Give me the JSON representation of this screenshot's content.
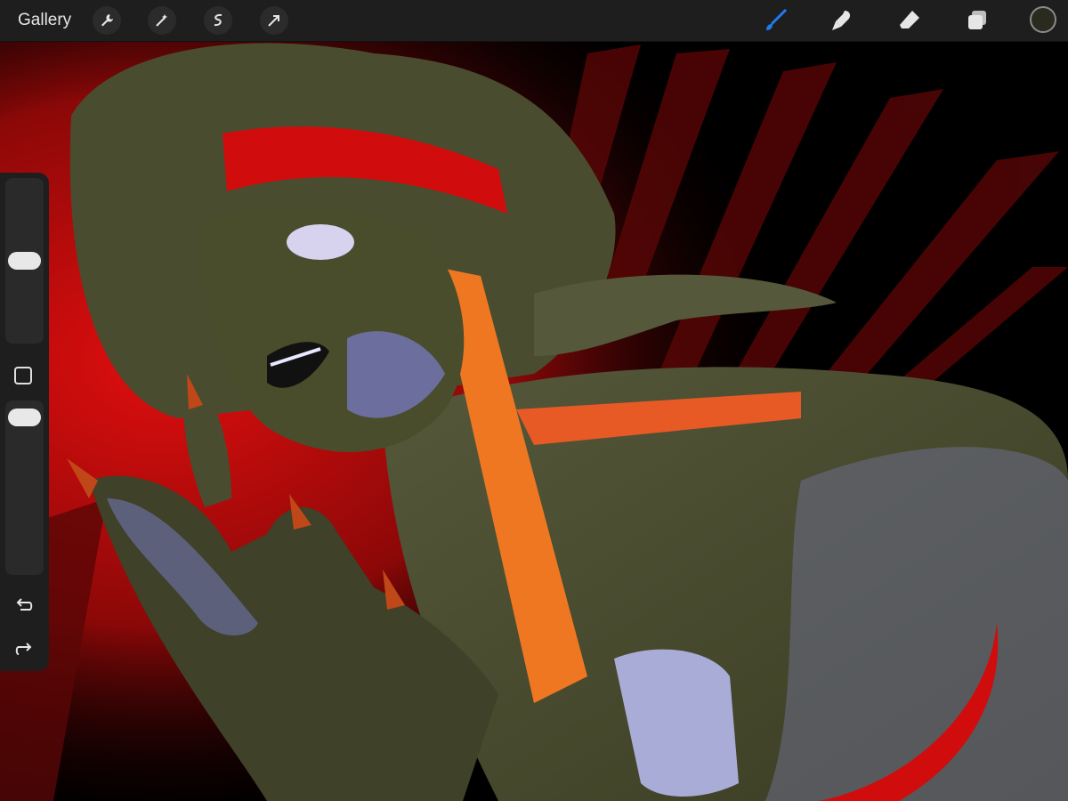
{
  "app": {
    "gallery_label": "Gallery",
    "left_tools": [
      {
        "name": "actions-icon"
      },
      {
        "name": "adjustments-icon"
      },
      {
        "name": "selection-icon"
      },
      {
        "name": "transform-icon"
      }
    ],
    "right_tools": [
      {
        "name": "brush-icon",
        "active": true
      },
      {
        "name": "smudge-icon",
        "active": false
      },
      {
        "name": "eraser-icon",
        "active": false
      },
      {
        "name": "layers-icon",
        "active": false
      }
    ],
    "current_color": "#2a2a1f",
    "accent_color": "#1e7cf2"
  },
  "sidebar": {
    "brush_size_level": 0.5,
    "opacity_level": 0.95,
    "modify_button": "square-icon",
    "undo": "undo-icon",
    "redo": "redo-icon"
  },
  "artwork": {
    "palette": [
      "#000000",
      "#d10c0c",
      "#4a4d2c",
      "#f07722",
      "#7a7ccf",
      "#e85a25"
    ]
  }
}
